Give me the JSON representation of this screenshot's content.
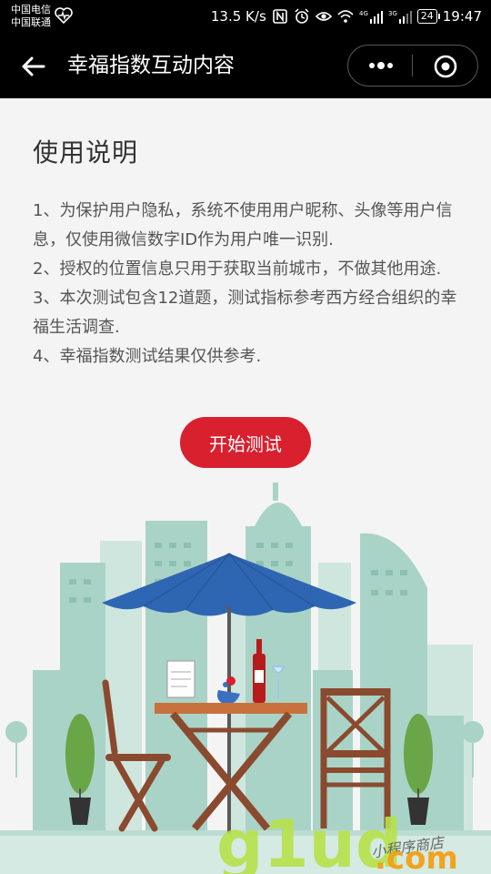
{
  "status": {
    "carrier1": "中国电信",
    "carrier2": "中国联通",
    "speed": "13.5 K/s",
    "net_4g": "4G",
    "net_3g": "3G",
    "battery": "24",
    "time": "19:47"
  },
  "nav": {
    "title": "幸福指数互动内容"
  },
  "main": {
    "section_title": "使用说明",
    "instructions": [
      "1、为保护用户隐私，系统不使用用户昵称、头像等用户信息，仅使用微信数字ID作为用户唯一识别.",
      "2、授权的位置信息只用于获取当前城市，不做其他用途.",
      "3、本次测试包含12道题，测试指标参考西方经合组织的幸福生活调查.",
      "4、幸福指数测试结果仅供参考."
    ],
    "start_button": "开始测试"
  },
  "watermark": {
    "logo": "g1ud",
    "tagline": "小程序商店",
    "domain": ".com"
  },
  "colors": {
    "accent": "#d8202f",
    "navbar": "#000000",
    "background": "#f4f4f4",
    "umbrella": "#2f66b3",
    "buildings": "#a9d3c6",
    "wood": "#8a4a2f"
  }
}
